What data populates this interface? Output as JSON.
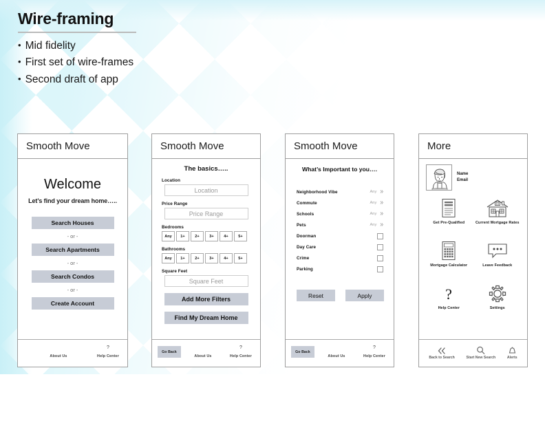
{
  "slide": {
    "title": "Wire-framing",
    "bullets": [
      "Mid fidelity",
      "First set of wire-frames",
      "Second draft of app"
    ],
    "bullet_char": "•"
  },
  "theme": {
    "pattern_color": "#d9f5fa",
    "button_fill": "#c7ccd6",
    "frame_border": "#9d9d9d",
    "placeholder_text": "#9a9a9a"
  },
  "common": {
    "app_name": "Smooth Move",
    "footer": {
      "about": "About Us",
      "help": "Help Center",
      "help_icon": "?",
      "go_back": "Go Back"
    }
  },
  "screen1": {
    "header": "Smooth Move",
    "title": "Welcome",
    "subtitle": "Let’s find your dream home…..",
    "separator": "- or -",
    "buttons": [
      "Search Houses",
      "Search Apartments",
      "Search Condos",
      "Create Account"
    ]
  },
  "screen2": {
    "header": "Smooth Move",
    "title": "The basics…..",
    "fields": [
      {
        "label": "Location",
        "placeholder": "Location"
      },
      {
        "label": "Price Range",
        "placeholder": "Price Range"
      }
    ],
    "segments": [
      {
        "label": "Bedrooms",
        "options": [
          "Any",
          "1+",
          "2+",
          "3+",
          "4+",
          "5+"
        ]
      },
      {
        "label": "Bathrooms",
        "options": [
          "Any",
          "1+",
          "2+",
          "3+",
          "4+",
          "5+"
        ]
      }
    ],
    "square_feet": {
      "label": "Square Feet",
      "placeholder": "Square Feet"
    },
    "actions": [
      "Add More Filters",
      "Find My Dream Home"
    ]
  },
  "screen3": {
    "header": "Smooth Move",
    "title": "What’s Important to you….",
    "any_label": "Any",
    "chevron": "»",
    "select_rows": [
      "Neighborhood Vibe",
      "Commute",
      "Schools",
      "Pets"
    ],
    "check_rows": [
      "Doorman",
      "Day Care",
      "Crime",
      "Parking"
    ],
    "reset": "Reset",
    "apply": "Apply"
  },
  "screen4": {
    "header": "More",
    "profile": {
      "name": "Name",
      "email": "Email",
      "avatar_icon": "user-portrait-icon"
    },
    "grid": [
      {
        "label": "Get Pre-Qualified",
        "icon": "document-icon"
      },
      {
        "label": "Current Mortgage Rates",
        "icon": "house-icon"
      },
      {
        "label": "Mortgage Calculator",
        "icon": "calculator-icon"
      },
      {
        "label": "Leave Feedback",
        "icon": "speech-bubble-icon"
      },
      {
        "label": "Help Center",
        "icon": "question-mark-icon"
      },
      {
        "label": "Settings",
        "icon": "gear-icon"
      }
    ],
    "nav": [
      {
        "label": "Back to Search",
        "icon": "double-chevron-left-icon",
        "glyph": "«"
      },
      {
        "label": "Start New Search",
        "icon": "magnifier-icon"
      },
      {
        "label": "Alerts",
        "icon": "bell-icon"
      }
    ]
  }
}
